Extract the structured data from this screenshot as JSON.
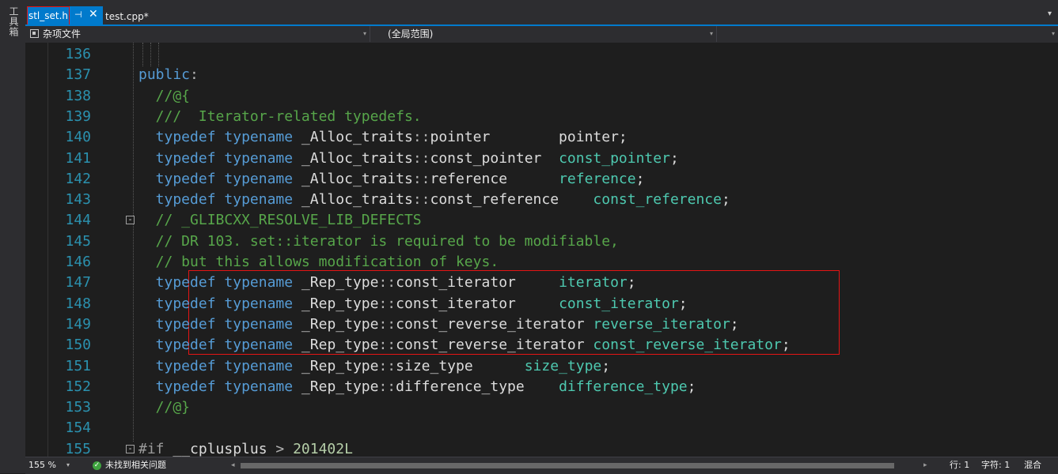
{
  "toolbox": {
    "label": "工具箱"
  },
  "tabs": {
    "active": {
      "name": "stl_set.h",
      "pin": "⊣",
      "close": "✕"
    },
    "inactive": {
      "name": "test.cpp*"
    },
    "overflow": "▾"
  },
  "navbar": {
    "project": "杂项文件",
    "scope": "(全局范围)",
    "member": "",
    "arrow": "▾"
  },
  "editor": {
    "lines": [
      {
        "num": "136"
      },
      {
        "num": "137",
        "parts": [
          [
            "kw",
            "public"
          ],
          [
            "op",
            ":"
          ]
        ]
      },
      {
        "num": "138",
        "parts": [
          [
            "cm",
            "  //@{"
          ]
        ]
      },
      {
        "num": "139",
        "parts": [
          [
            "cm",
            "  ///  Iterator-related typedefs."
          ]
        ]
      },
      {
        "num": "140",
        "parts": [
          [
            "kw",
            "  typedef"
          ],
          [
            "ty",
            " "
          ],
          [
            "kw",
            "typename"
          ],
          [
            "ty",
            " _Alloc_traits"
          ],
          [
            "op",
            "::"
          ],
          [
            "ty",
            "pointer        pointer;"
          ]
        ]
      },
      {
        "num": "141",
        "parts": [
          [
            "kw",
            "  typedef"
          ],
          [
            "ty",
            " "
          ],
          [
            "kw",
            "typename"
          ],
          [
            "ty",
            " _Alloc_traits"
          ],
          [
            "op",
            "::"
          ],
          [
            "ty",
            "const_pointer  "
          ],
          [
            "tdn",
            "const_pointer"
          ],
          [
            "ty",
            ";"
          ]
        ]
      },
      {
        "num": "142",
        "parts": [
          [
            "kw",
            "  typedef"
          ],
          [
            "ty",
            " "
          ],
          [
            "kw",
            "typename"
          ],
          [
            "ty",
            " _Alloc_traits"
          ],
          [
            "op",
            "::"
          ],
          [
            "ty",
            "reference      "
          ],
          [
            "tdn",
            "reference"
          ],
          [
            "ty",
            ";"
          ]
        ]
      },
      {
        "num": "143",
        "parts": [
          [
            "kw",
            "  typedef"
          ],
          [
            "ty",
            " "
          ],
          [
            "kw",
            "typename"
          ],
          [
            "ty",
            " _Alloc_traits"
          ],
          [
            "op",
            "::"
          ],
          [
            "ty",
            "const_reference    "
          ],
          [
            "tdn",
            "const_reference"
          ],
          [
            "ty",
            ";"
          ]
        ]
      },
      {
        "num": "144",
        "parts": [
          [
            "cm",
            "  // _GLIBCXX_RESOLVE_LIB_DEFECTS"
          ]
        ]
      },
      {
        "num": "145",
        "parts": [
          [
            "cm",
            "  // DR 103. set::iterator is required to be modifiable,"
          ]
        ]
      },
      {
        "num": "146",
        "parts": [
          [
            "cm",
            "  // but this allows modification of keys."
          ]
        ]
      },
      {
        "num": "147",
        "parts": [
          [
            "kw",
            "  typedef"
          ],
          [
            "ty",
            " "
          ],
          [
            "kw",
            "typename"
          ],
          [
            "ty",
            " _Rep_type"
          ],
          [
            "op",
            "::"
          ],
          [
            "ty",
            "const_iterator     "
          ],
          [
            "tdn",
            "iterator"
          ],
          [
            "ty",
            ";"
          ]
        ]
      },
      {
        "num": "148",
        "parts": [
          [
            "kw",
            "  typedef"
          ],
          [
            "ty",
            " "
          ],
          [
            "kw",
            "typename"
          ],
          [
            "ty",
            " _Rep_type"
          ],
          [
            "op",
            "::"
          ],
          [
            "ty",
            "const_iterator     "
          ],
          [
            "tdn",
            "const_iterator"
          ],
          [
            "ty",
            ";"
          ]
        ]
      },
      {
        "num": "149",
        "parts": [
          [
            "kw",
            "  typedef"
          ],
          [
            "ty",
            " "
          ],
          [
            "kw",
            "typename"
          ],
          [
            "ty",
            " _Rep_type"
          ],
          [
            "op",
            "::"
          ],
          [
            "ty",
            "const_reverse_iterator "
          ],
          [
            "tdn",
            "reverse_iterator"
          ],
          [
            "ty",
            ";"
          ]
        ]
      },
      {
        "num": "150",
        "parts": [
          [
            "kw",
            "  typedef"
          ],
          [
            "ty",
            " "
          ],
          [
            "kw",
            "typename"
          ],
          [
            "ty",
            " _Rep_type"
          ],
          [
            "op",
            "::"
          ],
          [
            "ty",
            "const_reverse_iterator "
          ],
          [
            "tdn",
            "const_reverse_iterator"
          ],
          [
            "ty",
            ";"
          ]
        ]
      },
      {
        "num": "151",
        "parts": [
          [
            "kw",
            "  typedef"
          ],
          [
            "ty",
            " "
          ],
          [
            "kw",
            "typename"
          ],
          [
            "ty",
            " _Rep_type"
          ],
          [
            "op",
            "::"
          ],
          [
            "ty",
            "size_type      "
          ],
          [
            "tdn",
            "size_type"
          ],
          [
            "ty",
            ";"
          ]
        ]
      },
      {
        "num": "152",
        "parts": [
          [
            "kw",
            "  typedef"
          ],
          [
            "ty",
            " "
          ],
          [
            "kw",
            "typename"
          ],
          [
            "ty",
            " _Rep_type"
          ],
          [
            "op",
            "::"
          ],
          [
            "ty",
            "difference_type    "
          ],
          [
            "tdn",
            "difference_type"
          ],
          [
            "ty",
            ";"
          ]
        ]
      },
      {
        "num": "153",
        "parts": [
          [
            "cm",
            "  //@}"
          ]
        ]
      },
      {
        "num": "154"
      },
      {
        "num": "155",
        "parts": [
          [
            "pp",
            "#if"
          ],
          [
            "ty",
            " __cplusplus "
          ],
          [
            "op",
            ">"
          ],
          [
            "num",
            " 201402L"
          ]
        ]
      }
    ]
  },
  "statusbar": {
    "zoom": "155 %",
    "zoom_arrow": "▾",
    "issues_icon": "✓",
    "issues": "未找到相关问题",
    "scroll_left": "◂",
    "scroll_right": "▸",
    "line": "行: 1",
    "col": "字符: 1",
    "mode": "混合"
  },
  "colors": {
    "accent": "#007acc",
    "highlight": "#e51414",
    "keyword": "#569cd6",
    "comment": "#57a64a",
    "line_number": "#2b91af"
  }
}
